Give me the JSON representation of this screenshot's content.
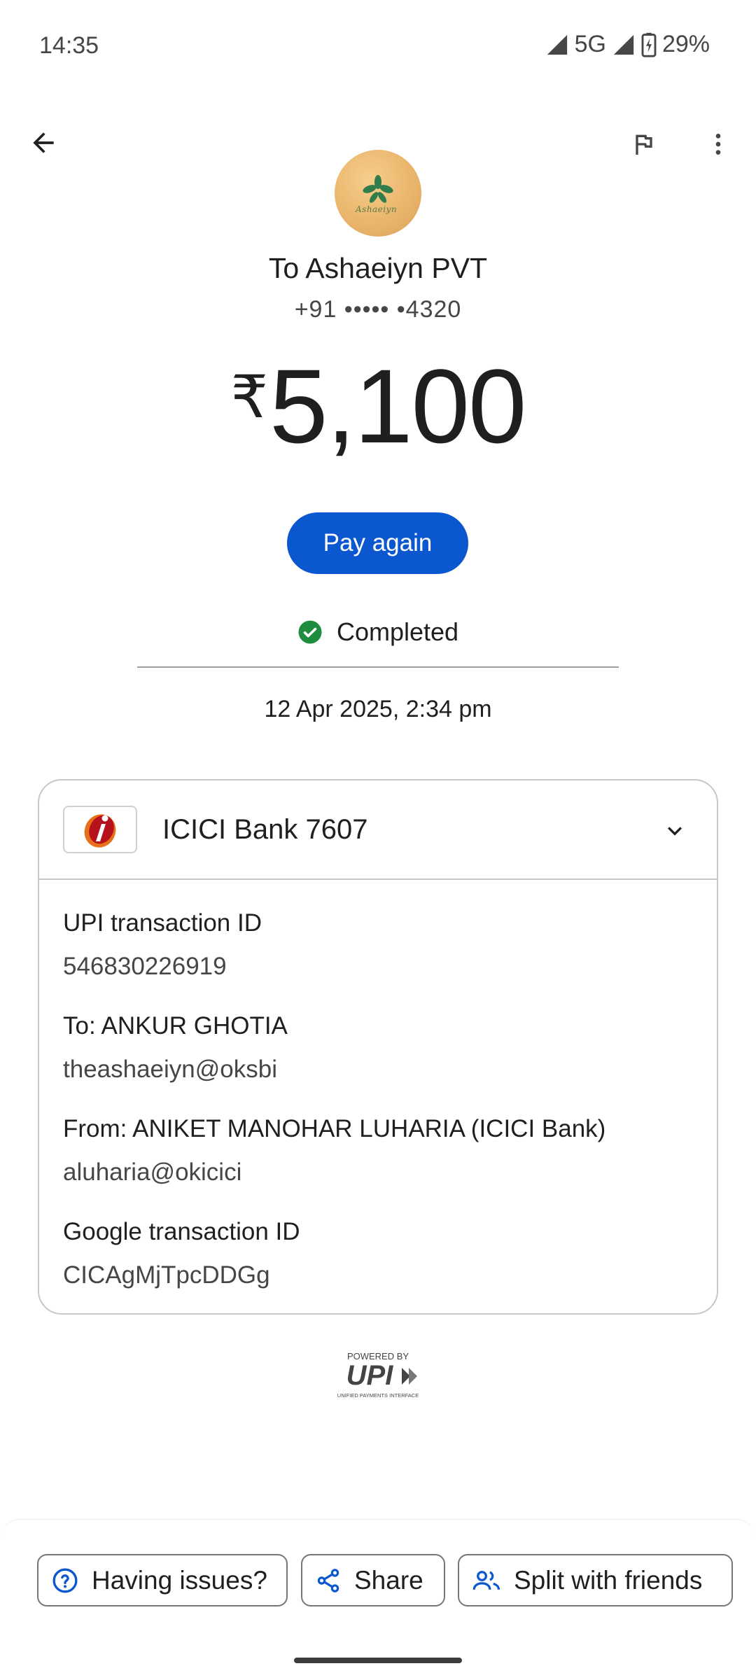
{
  "status_bar": {
    "time": "14:35",
    "network": "5G",
    "battery": "29%"
  },
  "top_bar": {
    "back_icon": "arrow-back-icon",
    "flag_icon": "flag-icon",
    "more_icon": "more-vert-icon"
  },
  "payee": {
    "name": "To Ashaeiyn PVT",
    "phone": "+91 ••••• •4320",
    "avatar_text": "Ashaeiyn"
  },
  "amount": {
    "currency": "₹",
    "value": "5,100"
  },
  "pay_again_label": "Pay again",
  "status": {
    "label": "Completed",
    "color": "#1e8e3e"
  },
  "date": "12 Apr 2025, 2:34 pm",
  "card": {
    "bank_name": "ICICI Bank 7607",
    "details": [
      {
        "label": "UPI transaction ID",
        "value": "546830226919"
      },
      {
        "label": "To: ANKUR GHOTIA",
        "value": "theashaeiyn@oksbi"
      },
      {
        "label": "From: ANIKET MANOHAR LUHARIA (ICICI Bank)",
        "value": "aluharia@okicici"
      },
      {
        "label": "Google transaction ID",
        "value": "CICAgMjTpcDDGg"
      }
    ]
  },
  "upi": {
    "powered_by": "POWERED BY",
    "logo": "UPI",
    "tagline": "UNIFIED PAYMENTS INTERFACE"
  },
  "actions": {
    "issues": "Having issues?",
    "share": "Share",
    "split": "Split with friends"
  },
  "colors": {
    "accent": "#0b57d0",
    "success": "#1e8e3e"
  }
}
